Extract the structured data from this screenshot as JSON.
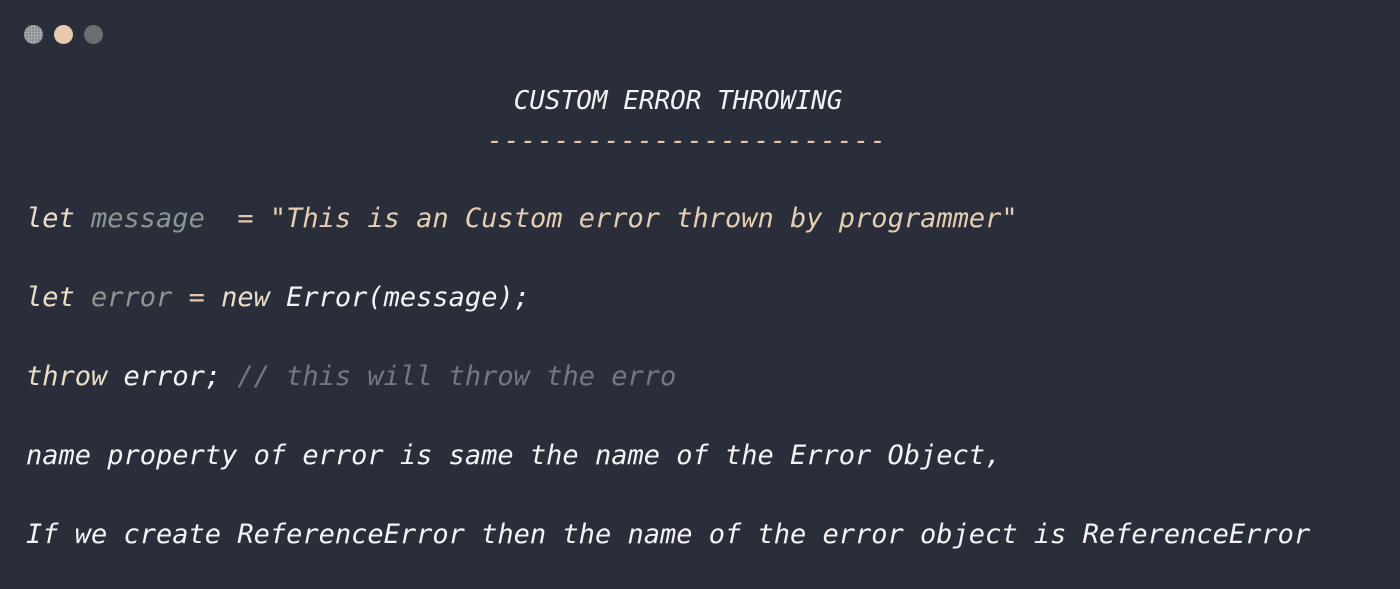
{
  "window": {
    "controls": [
      "close",
      "minimize",
      "zoom"
    ]
  },
  "title": "CUSTOM ERROR THROWING",
  "divider": "------------------------",
  "code": {
    "line1": {
      "kw": "let ",
      "var": "message",
      "op": "  = ",
      "str": "\"This is an Custom error thrown by programmer\""
    },
    "line2": {
      "kw": "let ",
      "var": "error",
      "op": " = ",
      "kw2": "new ",
      "plain": "Error(message);"
    },
    "line3": {
      "kw": "throw ",
      "plain": "error; ",
      "comment": "// this will throw the erro"
    },
    "line4": "name property of error is same the name of the Error Object,",
    "line5": "If we create ReferenceError then the name of the error object is ReferenceError"
  }
}
